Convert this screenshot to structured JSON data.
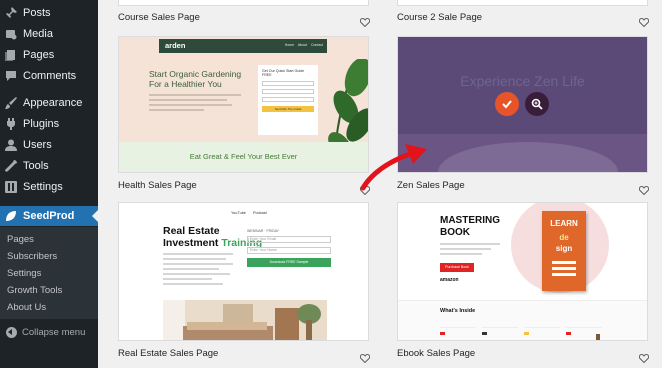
{
  "sidebar": {
    "menu": [
      {
        "label": "Posts",
        "icon": "pin-icon"
      },
      {
        "label": "Media",
        "icon": "media-icon"
      },
      {
        "label": "Pages",
        "icon": "page-icon"
      },
      {
        "label": "Comments",
        "icon": "comment-icon"
      },
      {
        "label": "Appearance",
        "icon": "brush-icon"
      },
      {
        "label": "Plugins",
        "icon": "plug-icon"
      },
      {
        "label": "Users",
        "icon": "user-icon"
      },
      {
        "label": "Tools",
        "icon": "wrench-icon"
      },
      {
        "label": "Settings",
        "icon": "settings-icon"
      }
    ],
    "active": {
      "label": "SeedProd",
      "icon": "seedprod-leaf-icon"
    },
    "submenu": [
      "Pages",
      "Subscribers",
      "Settings",
      "Growth Tools",
      "About Us"
    ],
    "collapse_label": "Collapse menu"
  },
  "templates": {
    "course": {
      "label": "Course Sales Page"
    },
    "course2": {
      "label": "Course 2 Sale Page"
    },
    "health": {
      "label": "Health Sales Page",
      "logo": "arden",
      "nav": "Home  About  Contact",
      "heading": "Start Organic Gardening For a Healthier You",
      "form_title": "Get Our Quick Start Guide FREE",
      "form_button": "Send Me The Guide",
      "footer": "Eat Great & Feel Your Best Ever"
    },
    "zen": {
      "label": "Zen Sales Page",
      "title": "Experience Zen Life"
    },
    "estate": {
      "label": "Real Estate Sales Page",
      "nav": "YouTube  Podcast",
      "heading_a": "Real Estate",
      "heading_b": "Investment",
      "heading_c": "Training",
      "form_label": "WEBINAR · FRIDAY",
      "field1": "Enter Your Email",
      "field2": "Enter Your Name",
      "button": "Download FREE Sample"
    },
    "ebook": {
      "label": "Ebook Sales Page",
      "title_1": "MASTERING",
      "title_2": "BOOK",
      "purchase": "Purchase Book",
      "amazon": "amazon",
      "cover_1": "LEARN",
      "cover_2": "de",
      "cover_3": "sign",
      "whats_inside": "What's Inside"
    }
  },
  "colors": {
    "sidebar_bg": "#1d2327",
    "active_blue": "#2271b1",
    "zen_check": "#e8542a",
    "zen_zoom": "#3a1d3a",
    "arrow_red": "#e3131b"
  }
}
